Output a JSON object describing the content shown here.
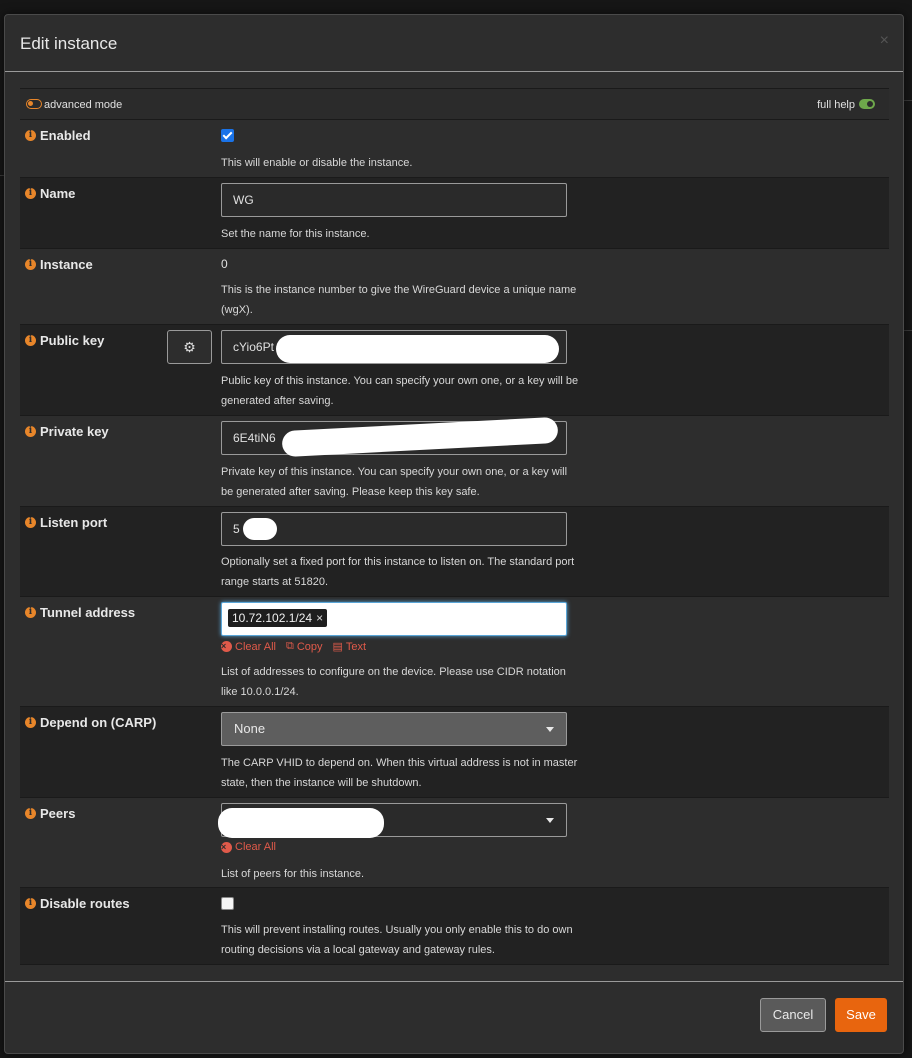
{
  "modal": {
    "title": "Edit instance",
    "close_icon": "×"
  },
  "toolbar": {
    "advanced_label": "advanced mode",
    "help_label": "full help"
  },
  "fields": {
    "enabled": {
      "label": "Enabled",
      "checked": true,
      "help": "This will enable or disable the instance."
    },
    "name": {
      "label": "Name",
      "value": "WG",
      "help": "Set the name for this instance."
    },
    "instance": {
      "label": "Instance",
      "value": "0",
      "help": "This is the instance number to give the WireGuard device a unique name (wgX)."
    },
    "public_key": {
      "label": "Public key",
      "value": "cYio6Pt",
      "help": "Public key of this instance. You can specify your own one, or a key will be generated after saving."
    },
    "private_key": {
      "label": "Private key",
      "value": "6E4tiN6",
      "help": "Private key of this instance. You can specify your own one, or a key will be generated after saving. Please keep this key safe."
    },
    "listen_port": {
      "label": "Listen port",
      "value": "5",
      "help": "Optionally set a fixed port for this instance to listen on. The standard port range starts at 51820."
    },
    "tunnel_address": {
      "label": "Tunnel address",
      "tag": "10.72.102.1/24",
      "clear_all": "Clear All",
      "copy": "Copy",
      "text": "Text",
      "help": "List of addresses to configure on the device. Please use CIDR notation like 10.0.0.1/24."
    },
    "depend_on": {
      "label": "Depend on (CARP)",
      "value": "None",
      "help": "The CARP VHID to depend on. When this virtual address is not in master state, then the instance will be shutdown."
    },
    "peers": {
      "label": "Peers",
      "clear_all": "Clear All",
      "help": "List of peers for this instance."
    },
    "disable_routes": {
      "label": "Disable routes",
      "checked": false,
      "help": "This will prevent installing routes. Usually you only enable this to do own routing decisions via a local gateway and gateway rules."
    }
  },
  "footer": {
    "cancel_label": "Cancel",
    "save_label": "Save"
  },
  "colors": {
    "accent": "#e8650e",
    "info": "#e8862a",
    "danger": "#e05a4a",
    "checkbox": "#1a73e8",
    "toggle_on": "#6ea84b"
  }
}
